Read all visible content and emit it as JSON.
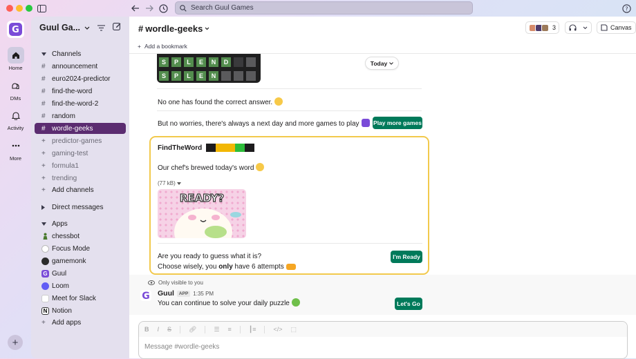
{
  "titlebar": {
    "search_placeholder": "Search Guul Games"
  },
  "rail": {
    "items": [
      {
        "label": "Home",
        "icon": "home-icon"
      },
      {
        "label": "DMs",
        "icon": "dms-icon"
      },
      {
        "label": "Activity",
        "icon": "bell-icon"
      },
      {
        "label": "More",
        "icon": "more-icon"
      }
    ]
  },
  "sidebar": {
    "workspace_name": "Guul Ga...",
    "channels_header": "Channels",
    "channels": [
      {
        "name": "announcement"
      },
      {
        "name": "euro2024-predictor"
      },
      {
        "name": "find-the-word"
      },
      {
        "name": "find-the-word-2"
      },
      {
        "name": "random"
      },
      {
        "name": "wordle-geeks"
      },
      {
        "name": "predictor-games"
      },
      {
        "name": "gaming-test"
      },
      {
        "name": "formula1"
      },
      {
        "name": "trending"
      }
    ],
    "add_channels": "Add channels",
    "dms_header": "Direct messages",
    "apps_header": "Apps",
    "apps": [
      {
        "name": "chessbot"
      },
      {
        "name": "Focus Mode"
      },
      {
        "name": "gamemonk"
      },
      {
        "name": "Guul"
      },
      {
        "name": "Loom"
      },
      {
        "name": "Meet for Slack"
      },
      {
        "name": "Notion"
      }
    ],
    "add_apps": "Add apps"
  },
  "header": {
    "channel": "wordle-geeks",
    "member_count": "3",
    "canvas_label": "Canvas",
    "bookmark_label": "Add a bookmark"
  },
  "messages": {
    "grid_rows": [
      [
        "S",
        "P",
        "L",
        "E",
        "N",
        "D",
        "",
        ""
      ],
      [
        "S",
        "P",
        "L",
        "E",
        "N",
        "",
        "",
        ""
      ]
    ],
    "today_label": "Today",
    "no_answer": "No one has found the correct answer.",
    "next_day": "But no worries, there's always a next day and more games to play",
    "play_more_button": "Play more games",
    "card": {
      "title": "FindTheWord",
      "chef_text": "Our chef's brewed today's word",
      "file_size": "(77 kB)",
      "gif_text": "READY?",
      "question_line1": "Are you ready to guess what it is?",
      "question_line2_pre": "Choose wisely, you ",
      "question_line2_bold": "only",
      "question_line2_post": " have 6 attempts",
      "ready_button": "I'm Ready"
    },
    "visible_note": "Only visible to you",
    "bot": {
      "name": "Guul",
      "badge": "APP",
      "time": "1:35 PM",
      "text": "You can continue to solve your daily puzzle",
      "button": "Let's Go"
    }
  },
  "composer": {
    "placeholder": "Message #wordle-geeks"
  },
  "colors": {
    "selected_channel": "#5b2c70",
    "green_button": "#007a5a",
    "card_border": "#f2c94c",
    "wordle_green": "#538d4e"
  }
}
